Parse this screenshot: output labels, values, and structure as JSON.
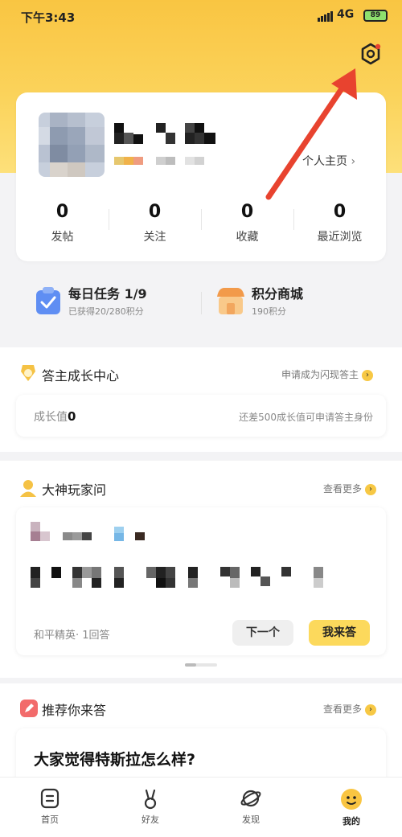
{
  "status_bar": {
    "time": "下午3:43",
    "network": "4G",
    "battery": "89"
  },
  "profile": {
    "homepage_link": "个人主页",
    "stats": [
      {
        "value": "0",
        "label": "发帖"
      },
      {
        "value": "0",
        "label": "关注"
      },
      {
        "value": "0",
        "label": "收藏"
      },
      {
        "value": "0",
        "label": "最近浏览"
      }
    ]
  },
  "tasks": {
    "daily": {
      "title": "每日任务 1/9",
      "subtitle": "已获得20/280积分"
    },
    "store": {
      "title": "积分商城",
      "subtitle": "190积分"
    }
  },
  "growth": {
    "title": "答主成长中心",
    "link": "申请成为闪现答主",
    "value_label": "成长值",
    "value": "0",
    "hint": "还差500成长值可申请答主身份"
  },
  "masters": {
    "title": "大神玩家问",
    "more": "查看更多",
    "meta": "和平精英· 1回答",
    "next_label": "下一个",
    "answer_label": "我来答"
  },
  "recommend": {
    "title": "推荐你来答",
    "more": "查看更多",
    "question": "大家觉得特斯拉怎么样?"
  },
  "tabbar": [
    {
      "label": "首页",
      "icon": "home-icon"
    },
    {
      "label": "好友",
      "icon": "friends-icon"
    },
    {
      "label": "发现",
      "icon": "planet-icon"
    },
    {
      "label": "我的",
      "icon": "me-icon"
    }
  ],
  "colors": {
    "brand_yellow": "#f9c542",
    "button_yellow": "#fcd95c",
    "arrow_red": "#e8432f"
  }
}
